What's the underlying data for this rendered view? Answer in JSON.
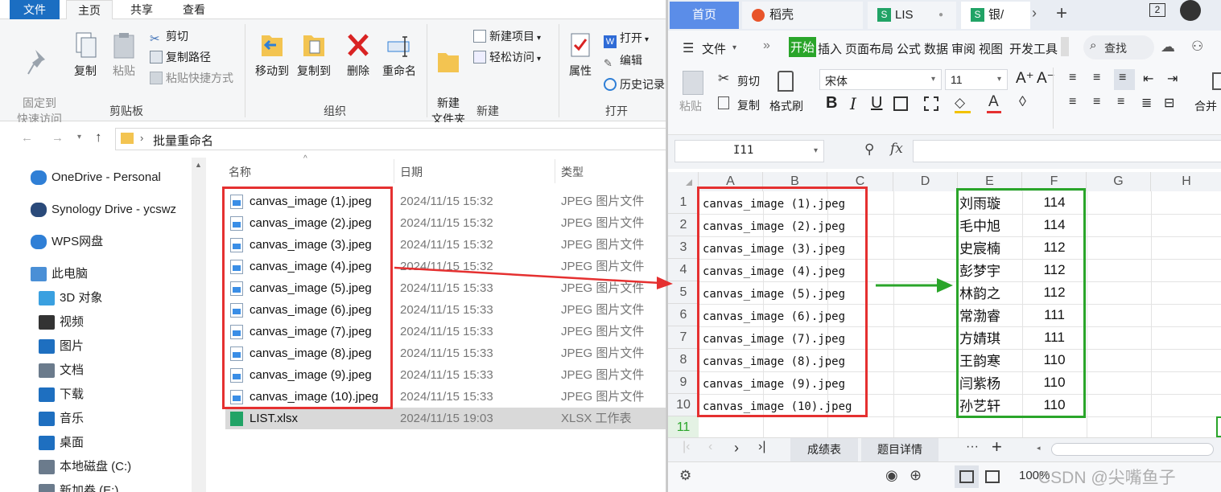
{
  "explorer": {
    "menu_tabs": [
      "文件",
      "主页",
      "共享",
      "查看"
    ],
    "ribbon": {
      "pin": "固定到\n快速访问",
      "copy": "复制",
      "paste": "粘贴",
      "cut": "剪切",
      "copy_path": "复制路径",
      "paste_shortcut": "粘贴快捷方式",
      "clipboard_group": "剪贴板",
      "move_to": "移动到",
      "copy_to": "复制到",
      "delete": "删除",
      "rename": "重命名",
      "organize_group": "组织",
      "new_folder": "新建\n文件夹",
      "new_item": "新建项目",
      "easy_access": "轻松访问",
      "new_group": "新建",
      "properties": "属性",
      "open": "打开",
      "edit": "编辑",
      "history": "历史记录",
      "open_group": "打开"
    },
    "address": {
      "folder": "批量重命名"
    },
    "nav_items": [
      "OneDrive - Personal",
      "Synology Drive - ycswz",
      "WPS网盘",
      "此电脑",
      "3D 对象",
      "视频",
      "图片",
      "文档",
      "下载",
      "音乐",
      "桌面",
      "本地磁盘 (C:)",
      "新加卷 (E:)"
    ],
    "columns": {
      "name": "名称",
      "date": "日期",
      "type": "类型"
    },
    "files": [
      {
        "name": "canvas_image (1).jpeg",
        "date": "2024/11/15 15:32",
        "type": "JPEG 图片文件"
      },
      {
        "name": "canvas_image (2).jpeg",
        "date": "2024/11/15 15:32",
        "type": "JPEG 图片文件"
      },
      {
        "name": "canvas_image (3).jpeg",
        "date": "2024/11/15 15:32",
        "type": "JPEG 图片文件"
      },
      {
        "name": "canvas_image (4).jpeg",
        "date": "2024/11/15 15:32",
        "type": "JPEG 图片文件"
      },
      {
        "name": "canvas_image (5).jpeg",
        "date": "2024/11/15 15:33",
        "type": "JPEG 图片文件"
      },
      {
        "name": "canvas_image (6).jpeg",
        "date": "2024/11/15 15:33",
        "type": "JPEG 图片文件"
      },
      {
        "name": "canvas_image (7).jpeg",
        "date": "2024/11/15 15:33",
        "type": "JPEG 图片文件"
      },
      {
        "name": "canvas_image (8).jpeg",
        "date": "2024/11/15 15:33",
        "type": "JPEG 图片文件"
      },
      {
        "name": "canvas_image (9).jpeg",
        "date": "2024/11/15 15:33",
        "type": "JPEG 图片文件"
      },
      {
        "name": "canvas_image (10).jpeg",
        "date": "2024/11/15 15:33",
        "type": "JPEG 图片文件"
      },
      {
        "name": "LIST.xlsx",
        "date": "2024/11/15 19:03",
        "type": "XLSX 工作表"
      }
    ]
  },
  "wps": {
    "tabs": {
      "home": "首页",
      "docer": "稻壳",
      "list": "LIS",
      "active": "银/"
    },
    "tab_badge": "2",
    "menu": {
      "file": "文件",
      "start": "开始",
      "insert": "插入",
      "layout": "页面布局",
      "formula": "公式",
      "data": "数据",
      "review": "审阅",
      "view": "视图",
      "dev": "开发工具",
      "search": "查找"
    },
    "toolbar": {
      "paste": "粘贴",
      "cut": "剪切",
      "copy": "复制",
      "format_painter": "格式刷",
      "font": "宋体",
      "size": "11",
      "merge": "合并"
    },
    "cell_ref": "I11",
    "fx": "fx",
    "columns": [
      "A",
      "B",
      "C",
      "D",
      "E",
      "F",
      "G",
      "H"
    ],
    "rows": [
      "1",
      "2",
      "3",
      "4",
      "5",
      "6",
      "7",
      "8",
      "9",
      "10",
      "11"
    ],
    "col_a": [
      "canvas_image (1).jpeg",
      "canvas_image (2).jpeg",
      "canvas_image (3).jpeg",
      "canvas_image (4).jpeg",
      "canvas_image (5).jpeg",
      "canvas_image (6).jpeg",
      "canvas_image (7).jpeg",
      "canvas_image (8).jpeg",
      "canvas_image (9).jpeg",
      "canvas_image (10).jpeg"
    ],
    "col_e": [
      "刘雨璇",
      "毛中旭",
      "史宸楠",
      "彭梦宇",
      "林韵之",
      "常渤睿",
      "方婧琪",
      "王韵寒",
      "闫紫杨",
      "孙艺轩"
    ],
    "col_f": [
      "114",
      "114",
      "112",
      "112",
      "112",
      "111",
      "111",
      "110",
      "110",
      "110"
    ],
    "sheets": [
      "成绩表",
      "题目详情"
    ],
    "zoom": "100%"
  },
  "watermark": "CSDN @尖嘴鱼子",
  "colors": {
    "annotation_red": "#e53030",
    "annotation_green": "#2aa52a",
    "accent_blue": "#1b6ec2"
  }
}
